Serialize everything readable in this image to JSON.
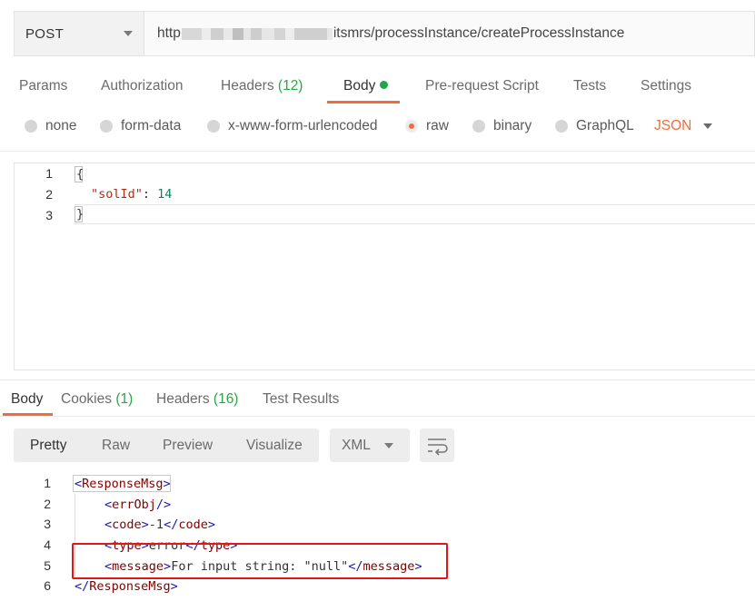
{
  "request": {
    "method": "POST",
    "url_prefix": "http",
    "url_suffix": "itsmrs/processInstance/createProcessInstance"
  },
  "request_tabs": [
    {
      "label": "Params"
    },
    {
      "label": "Authorization"
    },
    {
      "label": "Headers",
      "count": "(12)"
    },
    {
      "label": "Body"
    },
    {
      "label": "Pre-request Script"
    },
    {
      "label": "Tests"
    },
    {
      "label": "Settings"
    }
  ],
  "body_types": [
    {
      "label": "none",
      "selected": false
    },
    {
      "label": "form-data",
      "selected": false
    },
    {
      "label": "x-www-form-urlencoded",
      "selected": false
    },
    {
      "label": "raw",
      "selected": true
    },
    {
      "label": "binary",
      "selected": false
    },
    {
      "label": "GraphQL",
      "selected": false
    }
  ],
  "raw_format": "JSON",
  "request_body": {
    "line_numbers": [
      "1",
      "2",
      "3"
    ],
    "line1": "{",
    "key": "\"solId\"",
    "colon": ": ",
    "value": "14",
    "line3": "}"
  },
  "response_tabs": [
    {
      "label": "Body"
    },
    {
      "label": "Cookies",
      "count": "(1)"
    },
    {
      "label": "Headers",
      "count": "(16)"
    },
    {
      "label": "Test Results"
    }
  ],
  "view_modes": [
    "Pretty",
    "Raw",
    "Preview",
    "Visualize"
  ],
  "response_format": "XML",
  "response_body": {
    "line_numbers": [
      "1",
      "2",
      "3",
      "4",
      "5",
      "6"
    ],
    "root_tag": "ResponseMsg",
    "errobj_tag": "errObj",
    "code_tag": "code",
    "code_value": "-1",
    "type_tag": "type",
    "type_value": "error",
    "message_tag": "message",
    "message_value": "For input string: \"null\""
  },
  "colors": {
    "accent": "#f26b3a",
    "count_green": "#28a745",
    "highlight_red": "#e01818"
  }
}
